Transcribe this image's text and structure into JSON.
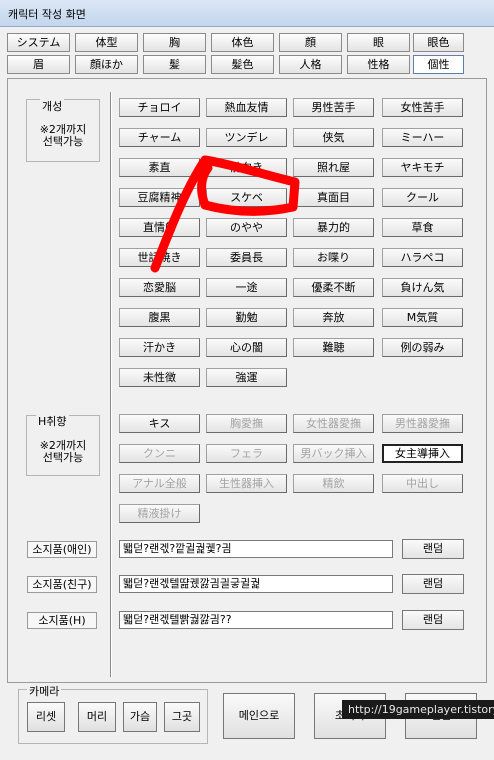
{
  "window": {
    "title": "캐릭터 작성 화면"
  },
  "tabs_row1": [
    "システム",
    "体型",
    "胸",
    "体色",
    "顔",
    "眼",
    "眼色"
  ],
  "tabs_row2": [
    "眉",
    "顔ほか",
    "髪",
    "髪色",
    "人格",
    "性格",
    "個性"
  ],
  "active_tab": "個性",
  "trait_group": {
    "title": "개성",
    "note": "※2개까지\n선택가능"
  },
  "trait_buttons": [
    "チョロイ",
    "熱血友情",
    "男性苦手",
    "女性苦手",
    "チャーム",
    "ツンデレ",
    "侠気",
    "ミーハー",
    "素直",
    "前向き",
    "照れ屋",
    "ヤキモチ",
    "豆腐精神",
    "スケベ",
    "真面目",
    "クール",
    "直情的",
    "のやや",
    "暴力的",
    "草食",
    "世話焼き",
    "委員長",
    "お喋り",
    "ハラペコ",
    "恋愛脳",
    "一途",
    "優柔不断",
    "負けん気",
    "腹黒",
    "勤勉",
    "奔放",
    "M気質",
    "汗かき",
    "心の闇",
    "難聴",
    "例の弱み",
    "未性徴",
    "強運"
  ],
  "h_group": {
    "title": "H취향",
    "note": "※2개까지\n선택가능"
  },
  "h_buttons": [
    {
      "label": "キス",
      "state": "normal"
    },
    {
      "label": "胸愛撫",
      "state": "disabled"
    },
    {
      "label": "女性器愛撫",
      "state": "disabled"
    },
    {
      "label": "男性器愛撫",
      "state": "disabled"
    },
    {
      "label": "クンニ",
      "state": "disabled"
    },
    {
      "label": "フェラ",
      "state": "disabled"
    },
    {
      "label": "男バック挿入",
      "state": "disabled"
    },
    {
      "label": "女主導挿入",
      "state": "selected"
    },
    {
      "label": "アナル全般",
      "state": "disabled"
    },
    {
      "label": "生性器挿入",
      "state": "disabled"
    },
    {
      "label": "精飲",
      "state": "disabled"
    },
    {
      "label": "中出し",
      "state": "disabled"
    },
    {
      "label": "精液掛け",
      "state": "disabled"
    }
  ],
  "items": [
    {
      "label": "소지품(애인)",
      "value": "뙓덛?랜겏?깥귈궕궻?긤",
      "random": "랜덤"
    },
    {
      "label": "소지품(친구)",
      "value": "뙓덛?랜겏텔땶궸깛긤긜긓귈궕",
      "random": "랜덤"
    },
    {
      "label": "소지품(H)",
      "value": "뙓덛?랜겏텔빩궗깛긤??",
      "random": "랜덤"
    }
  ],
  "camera": {
    "title": "카메라",
    "buttons": [
      "리셋",
      "머리",
      "가슴",
      "그곳"
    ]
  },
  "bottom_buttons": {
    "main": "메인으로",
    "init": "초기화",
    "random": "랜덤"
  },
  "watermark": "http://19gameplayer.tistory",
  "annotation_color": "#ff0000"
}
